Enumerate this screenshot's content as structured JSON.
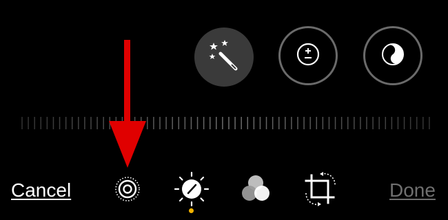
{
  "adjustments": [
    {
      "icon": "magic-wand-icon",
      "name": "auto-enhance",
      "selected": true
    },
    {
      "icon": "exposure-plus-minus-icon",
      "name": "exposure",
      "selected": false
    },
    {
      "icon": "contrast-yinyang-icon",
      "name": "contrast",
      "selected": false
    }
  ],
  "toolbar": {
    "cancel_label": "Cancel",
    "done_label": "Done",
    "tools": [
      {
        "icon": "live-photo-icon",
        "name": "live"
      },
      {
        "icon": "adjust-dial-icon",
        "name": "adjust",
        "active": true
      },
      {
        "icon": "filters-icon",
        "name": "filters"
      },
      {
        "icon": "crop-rotate-icon",
        "name": "crop"
      }
    ]
  },
  "annotation": {
    "icon": "red-arrow-icon",
    "color": "#e00000"
  },
  "colors": {
    "background": "#000000",
    "selected_circle": "#3a3a3a",
    "ring": "#6a6a6a",
    "active_dot": "#f4b400",
    "done_disabled": "#6f6f6f"
  }
}
